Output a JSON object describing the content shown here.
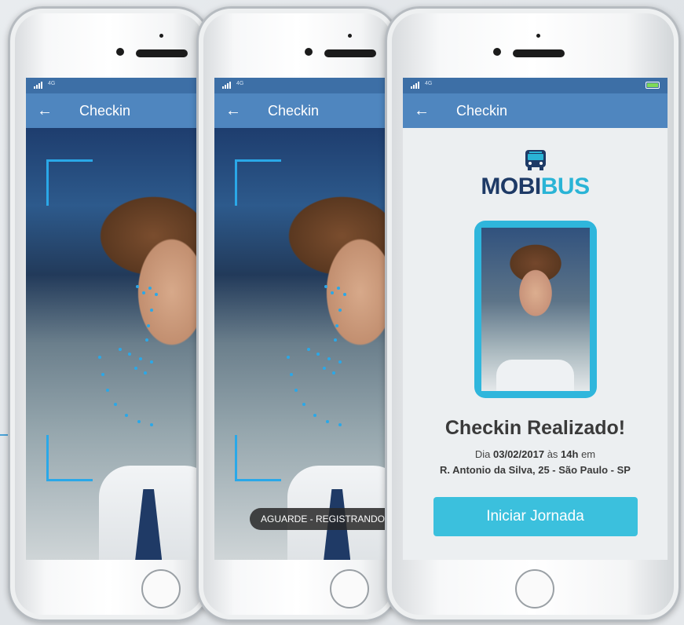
{
  "screens": [
    {
      "status": {
        "carrier": "4G"
      },
      "appbar": {
        "back_icon": "←",
        "title": "Checkin"
      }
    },
    {
      "status": {
        "carrier": "4G"
      },
      "appbar": {
        "back_icon": "←",
        "title": "Checkin"
      },
      "toast": "AGUARDE - REGISTRANDO..."
    },
    {
      "status": {
        "carrier": "4G"
      },
      "appbar": {
        "back_icon": "←",
        "title": "Checkin"
      }
    }
  ],
  "result": {
    "brand_part1": "MOBI",
    "brand_part2": "BUS",
    "title": "Checkin Realizado!",
    "date_prefix": "Dia ",
    "date": "03/02/2017",
    "date_mid": " às ",
    "time": "14h",
    "date_suffix": " em",
    "address": "R. Antonio da Silva, 25 - São Paulo - SP",
    "button_label": "Iniciar Jornada"
  },
  "colors": {
    "appbar": "#4f86bf",
    "accent": "#3bc0dd",
    "brand_dark": "#1e3a66",
    "brand_light": "#2ab4d6"
  },
  "icons": [
    "signal-icon",
    "battery-icon",
    "back-arrow-icon",
    "bus-icon",
    "home-button"
  ]
}
